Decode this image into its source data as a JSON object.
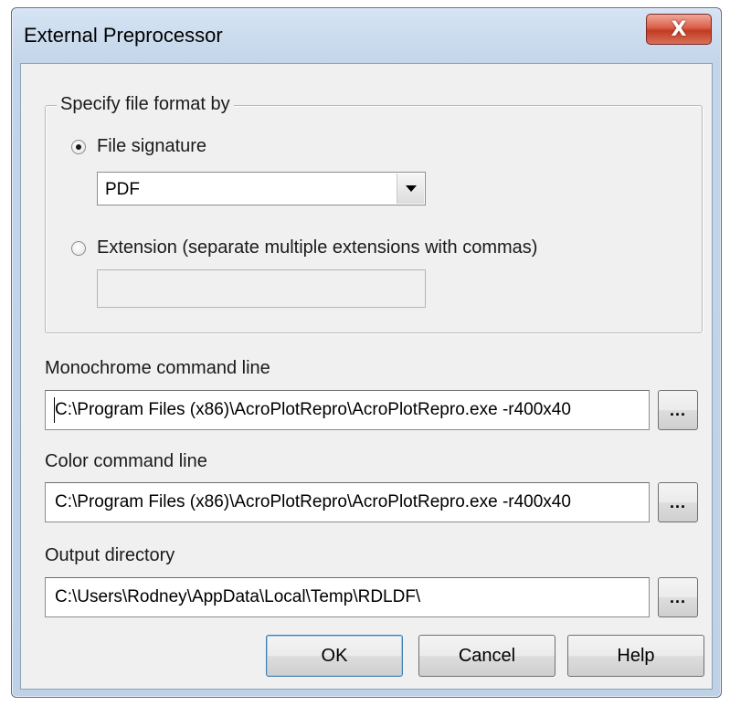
{
  "window": {
    "title": "External Preprocessor",
    "close_glyph": "X"
  },
  "format_group": {
    "label": "Specify file format by",
    "signature_option": {
      "label": "File signature",
      "selected": true
    },
    "signature_value": "PDF",
    "extension_option": {
      "label": "Extension (separate multiple extensions with commas)",
      "selected": false
    },
    "extension_value": ""
  },
  "monochrome": {
    "label": "Monochrome command line",
    "value": "C:\\Program Files (x86)\\AcroPlotRepro\\AcroPlotRepro.exe -r400x40",
    "browse_label": "..."
  },
  "color": {
    "label": "Color command line",
    "value": "C:\\Program Files (x86)\\AcroPlotRepro\\AcroPlotRepro.exe -r400x40",
    "browse_label": "..."
  },
  "output": {
    "label": "Output directory",
    "value": "C:\\Users\\Rodney\\AppData\\Local\\Temp\\RDLDF\\",
    "browse_label": "..."
  },
  "buttons": {
    "ok": "OK",
    "cancel": "Cancel",
    "help": "Help"
  },
  "colors": {
    "title_bar": "#c9daee",
    "client_background": "#f0f0f0",
    "close_button": "#c9452c"
  }
}
